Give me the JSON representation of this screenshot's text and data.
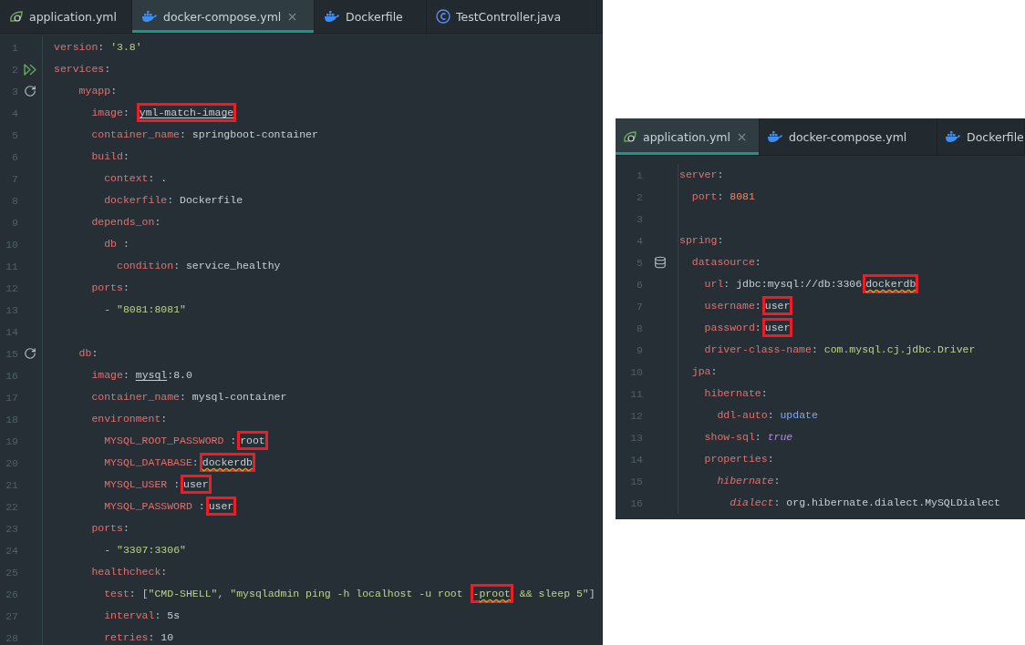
{
  "editors": [
    {
      "tabs": [
        {
          "label": "application.yml",
          "kind": "spring",
          "selected": false
        },
        {
          "label": "docker-compose.yml",
          "kind": "docker",
          "selected": true
        },
        {
          "label": "Dockerfile",
          "kind": "docker",
          "selected": false
        },
        {
          "label": "TestController.java",
          "kind": "class",
          "selected": false
        }
      ],
      "lines": [
        {
          "number": "1",
          "tokens": [
            {
              "kind": "key",
              "text": "version"
            },
            {
              "kind": "punct",
              "text": ": "
            },
            {
              "kind": "string",
              "text": "'3.8'"
            }
          ]
        },
        {
          "number": "2",
          "gutter": {
            "kind": "run"
          },
          "tokens": [
            {
              "kind": "key",
              "text": "services"
            },
            {
              "kind": "punct",
              "text": ":"
            }
          ]
        },
        {
          "number": "3",
          "gutter": {
            "kind": "reload"
          },
          "tokens": [
            {
              "kind": "key",
              "text": "    myapp"
            },
            {
              "kind": "punct",
              "text": ":"
            }
          ]
        },
        {
          "number": "4",
          "tokens": [
            {
              "kind": "key",
              "text": "      image"
            },
            {
              "kind": "punct",
              "text": ": "
            },
            {
              "kind": "box",
              "children": [
                {
                  "kind": "value",
                  "text": "yml-match-image",
                  "underlined": true
                }
              ]
            }
          ]
        },
        {
          "number": "5",
          "tokens": [
            {
              "kind": "key",
              "text": "      container_name"
            },
            {
              "kind": "punct",
              "text": ": "
            },
            {
              "kind": "value",
              "text": "springboot-container"
            }
          ]
        },
        {
          "number": "6",
          "tokens": [
            {
              "kind": "key",
              "text": "      build"
            },
            {
              "kind": "punct",
              "text": ":"
            }
          ]
        },
        {
          "number": "7",
          "tokens": [
            {
              "kind": "key",
              "text": "        context"
            },
            {
              "kind": "punct",
              "text": ": "
            },
            {
              "kind": "value",
              "text": "."
            }
          ]
        },
        {
          "number": "8",
          "tokens": [
            {
              "kind": "key",
              "text": "        dockerfile"
            },
            {
              "kind": "punct",
              "text": ": "
            },
            {
              "kind": "value",
              "text": "Dockerfile"
            }
          ]
        },
        {
          "number": "9",
          "tokens": [
            {
              "kind": "key",
              "text": "      depends_on"
            },
            {
              "kind": "punct",
              "text": ":"
            }
          ]
        },
        {
          "number": "10",
          "tokens": [
            {
              "kind": "key",
              "text": "        db"
            },
            {
              "kind": "punct",
              "text": " :"
            }
          ]
        },
        {
          "number": "11",
          "tokens": [
            {
              "kind": "key",
              "text": "          condition"
            },
            {
              "kind": "punct",
              "text": ": "
            },
            {
              "kind": "value",
              "text": "service_healthy"
            }
          ]
        },
        {
          "number": "12",
          "tokens": [
            {
              "kind": "key",
              "text": "      ports"
            },
            {
              "kind": "punct",
              "text": ":"
            }
          ]
        },
        {
          "number": "13",
          "tokens": [
            {
              "kind": "punct",
              "text": "        - "
            },
            {
              "kind": "string",
              "text": "\"8081:8081\""
            }
          ]
        },
        {
          "number": "14"
        },
        {
          "number": "15",
          "gutter": {
            "kind": "reload"
          },
          "tokens": [
            {
              "kind": "key",
              "text": "    db"
            },
            {
              "kind": "punct",
              "text": ":"
            }
          ]
        },
        {
          "number": "16",
          "tokens": [
            {
              "kind": "key",
              "text": "      image"
            },
            {
              "kind": "punct",
              "text": ": "
            },
            {
              "kind": "value",
              "text": "mysql",
              "underlined": true
            },
            {
              "kind": "value",
              "text": ":8.0"
            }
          ]
        },
        {
          "number": "17",
          "tokens": [
            {
              "kind": "key",
              "text": "      container_name"
            },
            {
              "kind": "punct",
              "text": ": "
            },
            {
              "kind": "value",
              "text": "mysql-container"
            }
          ]
        },
        {
          "number": "18",
          "tokens": [
            {
              "kind": "key",
              "text": "      environment"
            },
            {
              "kind": "punct",
              "text": ":"
            }
          ]
        },
        {
          "number": "19",
          "tokens": [
            {
              "kind": "key",
              "text": "        MYSQL_ROOT_PASSWORD"
            },
            {
              "kind": "punct",
              "text": " :"
            },
            {
              "kind": "box",
              "children": [
                {
                  "kind": "value",
                  "text": "root"
                }
              ]
            }
          ]
        },
        {
          "number": "20",
          "tokens": [
            {
              "kind": "key",
              "text": "        MYSQL_DATABASE"
            },
            {
              "kind": "punct",
              "text": ":"
            },
            {
              "kind": "box",
              "children": [
                {
                  "kind": "value",
                  "text": "dockerdb",
                  "warning": true
                }
              ]
            }
          ]
        },
        {
          "number": "21",
          "tokens": [
            {
              "kind": "key",
              "text": "        MYSQL_USER"
            },
            {
              "kind": "punct",
              "text": " :"
            },
            {
              "kind": "box",
              "children": [
                {
                  "kind": "value",
                  "text": "user"
                }
              ]
            }
          ]
        },
        {
          "number": "22",
          "tokens": [
            {
              "kind": "key",
              "text": "        MYSQL_PASSWORD"
            },
            {
              "kind": "punct",
              "text": " :"
            },
            {
              "kind": "box",
              "children": [
                {
                  "kind": "value",
                  "text": "user"
                }
              ]
            }
          ]
        },
        {
          "number": "23",
          "tokens": [
            {
              "kind": "key",
              "text": "      ports"
            },
            {
              "kind": "punct",
              "text": ":"
            }
          ]
        },
        {
          "number": "24",
          "tokens": [
            {
              "kind": "punct",
              "text": "        - "
            },
            {
              "kind": "string",
              "text": "\"3307:3306\""
            }
          ]
        },
        {
          "number": "25",
          "tokens": [
            {
              "kind": "key",
              "text": "      healthcheck"
            },
            {
              "kind": "punct",
              "text": ":"
            }
          ]
        },
        {
          "number": "26",
          "tokens": [
            {
              "kind": "key",
              "text": "        test"
            },
            {
              "kind": "punct",
              "text": ": ["
            },
            {
              "kind": "string",
              "text": "\"CMD-SHELL\""
            },
            {
              "kind": "punct",
              "text": ", "
            },
            {
              "kind": "string",
              "text": "\"mysqladmin ping -h localhost -u root "
            },
            {
              "kind": "box",
              "children": [
                {
                  "kind": "string",
                  "text": "-"
                },
                {
                  "kind": "string",
                  "text": "proot",
                  "warning": true
                }
              ]
            },
            {
              "kind": "string",
              "text": " && sleep 5\""
            },
            {
              "kind": "punct",
              "text": "]"
            }
          ]
        },
        {
          "number": "27",
          "tokens": [
            {
              "kind": "key",
              "text": "        interval"
            },
            {
              "kind": "punct",
              "text": ": "
            },
            {
              "kind": "value",
              "text": "5s"
            }
          ]
        },
        {
          "number": "28",
          "tokens": [
            {
              "kind": "key",
              "text": "        retries"
            },
            {
              "kind": "punct",
              "text": ": "
            },
            {
              "kind": "value",
              "text": "10"
            }
          ]
        }
      ]
    },
    {
      "tabs": [
        {
          "label": "application.yml",
          "kind": "spring",
          "selected": true
        },
        {
          "label": "docker-compose.yml",
          "kind": "docker",
          "selected": false
        },
        {
          "label": "Dockerfile",
          "kind": "docker",
          "selected": false
        }
      ],
      "lines": [
        {
          "number": "1",
          "tokens": [
            {
              "kind": "key",
              "text": "server"
            },
            {
              "kind": "punct",
              "text": ":"
            }
          ]
        },
        {
          "number": "2",
          "tokens": [
            {
              "kind": "key",
              "text": "  port"
            },
            {
              "kind": "punct",
              "text": ": "
            },
            {
              "kind": "number",
              "text": "8081"
            }
          ]
        },
        {
          "number": "3"
        },
        {
          "number": "4",
          "tokens": [
            {
              "kind": "key",
              "text": "spring"
            },
            {
              "kind": "punct",
              "text": ":"
            }
          ]
        },
        {
          "number": "5",
          "gutter": {
            "kind": "database"
          },
          "tokens": [
            {
              "kind": "key",
              "text": "  datasource"
            },
            {
              "kind": "punct",
              "text": ":"
            }
          ]
        },
        {
          "number": "6",
          "tokens": [
            {
              "kind": "key",
              "text": "    url"
            },
            {
              "kind": "punct",
              "text": ": "
            },
            {
              "kind": "value",
              "text": "jdbc:mysql://db:3306"
            },
            {
              "kind": "box",
              "children": [
                {
                  "kind": "value",
                  "text": "dockerdb",
                  "warning": true
                }
              ]
            }
          ]
        },
        {
          "number": "7",
          "tokens": [
            {
              "kind": "key",
              "text": "    username"
            },
            {
              "kind": "punct",
              "text": ":"
            },
            {
              "kind": "box",
              "children": [
                {
                  "kind": "value",
                  "text": "user"
                }
              ]
            }
          ]
        },
        {
          "number": "8",
          "tokens": [
            {
              "kind": "key",
              "text": "    password"
            },
            {
              "kind": "punct",
              "text": ":"
            },
            {
              "kind": "box",
              "children": [
                {
                  "kind": "value",
                  "text": "user"
                }
              ]
            }
          ]
        },
        {
          "number": "9",
          "tokens": [
            {
              "kind": "key",
              "text": "    driver-class-name"
            },
            {
              "kind": "punct",
              "text": ": "
            },
            {
              "kind": "class",
              "text": "com.mysql.cj.jdbc.Driver"
            }
          ]
        },
        {
          "number": "10",
          "tokens": [
            {
              "kind": "key",
              "text": "  jpa"
            },
            {
              "kind": "punct",
              "text": ":"
            }
          ]
        },
        {
          "number": "11",
          "tokens": [
            {
              "kind": "key",
              "text": "    hibernate"
            },
            {
              "kind": "punct",
              "text": ":"
            }
          ]
        },
        {
          "number": "12",
          "tokens": [
            {
              "kind": "key",
              "text": "      ddl-auto"
            },
            {
              "kind": "punct",
              "text": ": "
            },
            {
              "kind": "keyword",
              "text": "update"
            }
          ]
        },
        {
          "number": "13",
          "tokens": [
            {
              "kind": "key",
              "text": "    show-sql"
            },
            {
              "kind": "punct",
              "text": ": "
            },
            {
              "kind": "constant",
              "text": "true"
            }
          ]
        },
        {
          "number": "14",
          "tokens": [
            {
              "kind": "key",
              "text": "    properties"
            },
            {
              "kind": "punct",
              "text": ":"
            }
          ]
        },
        {
          "number": "15",
          "tokens": [
            {
              "kind": "custom-key",
              "text": "      hibernate"
            },
            {
              "kind": "punct",
              "text": ":"
            }
          ]
        },
        {
          "number": "16",
          "tokens": [
            {
              "kind": "custom-key",
              "text": "        dialect"
            },
            {
              "kind": "punct",
              "text": ": "
            },
            {
              "kind": "value",
              "text": "org.hibernate.dialect.MySQLDialect"
            }
          ]
        }
      ]
    }
  ]
}
